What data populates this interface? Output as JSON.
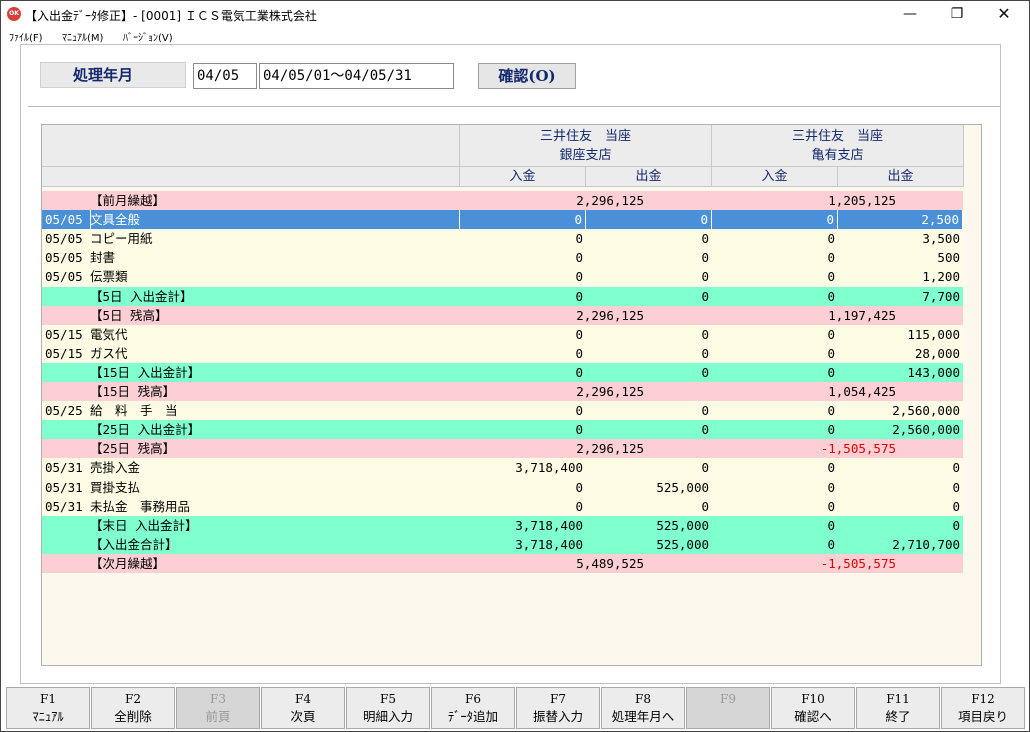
{
  "window": {
    "title": "【入出金ﾃﾞｰﾀ修正】- [0001] ＩＣＳ電気工業株式会社",
    "icon_label": "OK",
    "minimize": "—",
    "maximize": "❐",
    "close": "✕"
  },
  "menu": [
    "ﾌｧｲﾙ(F)",
    "ﾏﾆｭｱﾙ(M)",
    "ﾊﾞｰｼﾞｮﾝ(V)"
  ],
  "header": {
    "period_label": "処理年月",
    "year_month": "04/05",
    "date_range": "04/05/01～04/05/31",
    "confirm_button": "確認(O)"
  },
  "accounts": [
    {
      "bank": "三井住友　当座",
      "branch": "銀座支店",
      "in_label": "入金",
      "out_label": "出金"
    },
    {
      "bank": "三井住友　当座",
      "branch": "亀有支店",
      "in_label": "入金",
      "out_label": "出金"
    }
  ],
  "rows": [
    {
      "kind": "balance",
      "date": "",
      "desc": "【前月繰越】",
      "bal1": "2,296,125",
      "bal2": "1,205,125"
    },
    {
      "kind": "detail",
      "date": "05/05",
      "desc": "文具全般",
      "a1": "0",
      "b1": "0",
      "a2": "0",
      "b2": "2,500",
      "selected": true
    },
    {
      "kind": "detail",
      "date": "05/05",
      "desc": "コピー用紙",
      "a1": "0",
      "b1": "0",
      "a2": "0",
      "b2": "3,500"
    },
    {
      "kind": "detail",
      "date": "05/05",
      "desc": "封書",
      "a1": "0",
      "b1": "0",
      "a2": "0",
      "b2": "500"
    },
    {
      "kind": "detail",
      "date": "05/05",
      "desc": "伝票類",
      "a1": "0",
      "b1": "0",
      "a2": "0",
      "b2": "1,200"
    },
    {
      "kind": "subtotal",
      "date": "",
      "desc": "【5日 入出金計】",
      "a1": "0",
      "b1": "0",
      "a2": "0",
      "b2": "7,700"
    },
    {
      "kind": "balance",
      "date": "",
      "desc": "【5日 残高】",
      "bal1": "2,296,125",
      "bal2": "1,197,425"
    },
    {
      "kind": "detail",
      "date": "05/15",
      "desc": "電気代",
      "a1": "0",
      "b1": "0",
      "a2": "0",
      "b2": "115,000"
    },
    {
      "kind": "detail",
      "date": "05/15",
      "desc": "ガス代",
      "a1": "0",
      "b1": "0",
      "a2": "0",
      "b2": "28,000"
    },
    {
      "kind": "subtotal",
      "date": "",
      "desc": "【15日 入出金計】",
      "a1": "0",
      "b1": "0",
      "a2": "0",
      "b2": "143,000"
    },
    {
      "kind": "balance",
      "date": "",
      "desc": "【15日 残高】",
      "bal1": "2,296,125",
      "bal2": "1,054,425"
    },
    {
      "kind": "detail",
      "date": "05/25",
      "desc": "給　料　手　当",
      "a1": "0",
      "b1": "0",
      "a2": "0",
      "b2": "2,560,000"
    },
    {
      "kind": "subtotal",
      "date": "",
      "desc": "【25日 入出金計】",
      "a1": "0",
      "b1": "0",
      "a2": "0",
      "b2": "2,560,000"
    },
    {
      "kind": "balance",
      "date": "",
      "desc": "【25日 残高】",
      "bal1": "2,296,125",
      "bal2": "-1,505,575",
      "bal2_negative": true
    },
    {
      "kind": "detail",
      "date": "05/31",
      "desc": "売掛入金",
      "a1": "3,718,400",
      "b1": "0",
      "a2": "0",
      "b2": "0"
    },
    {
      "kind": "detail",
      "date": "05/31",
      "desc": "買掛支払",
      "a1": "0",
      "b1": "525,000",
      "a2": "0",
      "b2": "0"
    },
    {
      "kind": "detail",
      "date": "05/31",
      "desc": "未払金　事務用品",
      "a1": "0",
      "b1": "0",
      "a2": "0",
      "b2": "0"
    },
    {
      "kind": "subtotal",
      "date": "",
      "desc": "【末日 入出金計】",
      "a1": "3,718,400",
      "b1": "525,000",
      "a2": "0",
      "b2": "0"
    },
    {
      "kind": "subtotal",
      "date": "",
      "desc": "【入出金合計】",
      "a1": "3,718,400",
      "b1": "525,000",
      "a2": "0",
      "b2": "2,710,700"
    },
    {
      "kind": "balance",
      "date": "",
      "desc": "【次月繰越】",
      "bal1": "5,489,525",
      "bal2": "-1,505,575",
      "bal2_negative": true
    }
  ],
  "function_keys": [
    {
      "key": "F1",
      "label": "ﾏﾆｭｱﾙ",
      "enabled": true
    },
    {
      "key": "F2",
      "label": "全削除",
      "enabled": true
    },
    {
      "key": "F3",
      "label": "前頁",
      "enabled": false
    },
    {
      "key": "F4",
      "label": "次頁",
      "enabled": true
    },
    {
      "key": "F5",
      "label": "明細入力",
      "enabled": true
    },
    {
      "key": "F6",
      "label": "ﾃﾞｰﾀ追加",
      "enabled": true
    },
    {
      "key": "F7",
      "label": "振替入力",
      "enabled": true
    },
    {
      "key": "F8",
      "label": "処理年月へ",
      "enabled": true
    },
    {
      "key": "F9",
      "label": "",
      "enabled": false
    },
    {
      "key": "F10",
      "label": "確認へ",
      "enabled": true
    },
    {
      "key": "F11",
      "label": "終了",
      "enabled": true
    },
    {
      "key": "F12",
      "label": "項目戻り",
      "enabled": true
    }
  ]
}
